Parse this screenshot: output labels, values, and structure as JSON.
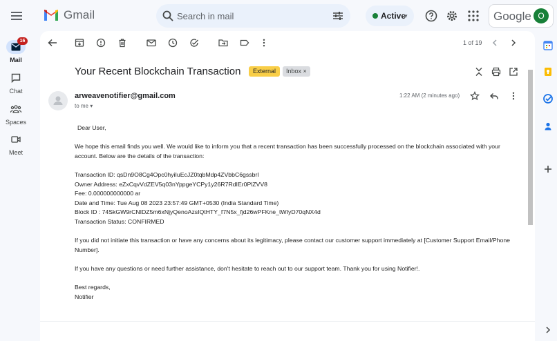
{
  "app": {
    "name": "Gmail",
    "account_brand": "Google",
    "avatar_letter": "O"
  },
  "search": {
    "placeholder": "Search in mail"
  },
  "status": {
    "label": "Active"
  },
  "nav": {
    "mail": {
      "label": "Mail",
      "badge": "16"
    },
    "chat": {
      "label": "Chat"
    },
    "spaces": {
      "label": "Spaces"
    },
    "meet": {
      "label": "Meet"
    }
  },
  "toolbar": {
    "pager": "1 of 19"
  },
  "email": {
    "subject": "Your Recent Blockchain Transaction",
    "labels": {
      "external": "External",
      "inbox": "Inbox ×"
    },
    "sender": "arweavenotifier@gmail.com",
    "recipient": "to me ▾",
    "time": "1:22 AM (2 minutes ago)",
    "body": {
      "greeting": "Dear User,",
      "intro": "We hope this email finds you well. We would like to inform you that a recent transaction has been successfully processed on the blockchain associated with your account. Below are the details of the transaction:",
      "transaction_id": "Transaction ID: qsDn9O8Cg4Opc0hyiIuEcJZ0tqbMdp4ZVbbC6gssbrI",
      "owner_address": "Owner Address: eZxCqvVdZEV5q03nYppgeYCPy1y26R7RdIEr0PlZVV8",
      "fee": "Fee: 0.000000000000 ar",
      "date_time": "Date and Time: Tue Aug 08 2023 23:57:49 GMT+0530 (India Standard Time)",
      "block_id": "Block ID : 74SkGW9rCNIDZ5m6xNjyQenoAzsIQtHTY_f7N5x_fjd26wPFKne_tWIyD70qNX4d",
      "transaction_status": "Transaction Status: CONFIRMED",
      "concerns": "If you did not initiate this transaction or have any concerns about its legitimacy, please contact our customer support immediately at [Customer Support Email/Phone Number].",
      "assistance": "If you have any questions or need further assistance, don't hesitate to reach out to our support team. Thank you for using Notifier!.",
      "signoff": "Best regards,",
      "signature": "Notifier"
    }
  },
  "colors": {
    "accent": "#0b57d0",
    "external_label": "#f9ce47",
    "badge": "#c5221f",
    "active_dot": "#188038"
  }
}
